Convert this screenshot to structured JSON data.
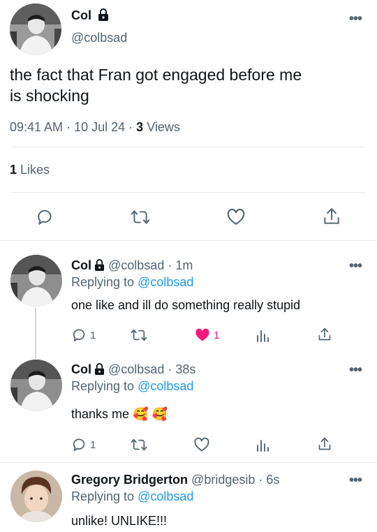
{
  "main_tweet": {
    "author_name": "Col",
    "author_handle": "@colbsad",
    "text_line1": "the fact that Fran got engaged before me",
    "text_line2": "is shocking",
    "time": "09:41 AM",
    "date": "10 Jul 24",
    "views_count": "3",
    "views_label": "Views",
    "likes_count": "1",
    "likes_label": "Likes"
  },
  "replies": [
    {
      "author_name": "Col",
      "author_handle": "@colbsad",
      "age": "· 1m",
      "replying_prefix": "Replying to",
      "replying_to": "@colbsad",
      "text": "one like and ill do something really stupid",
      "reply_count": "1",
      "retweet_count": "",
      "like_count": "1",
      "liked": true
    },
    {
      "author_name": "Col",
      "author_handle": "@colbsad",
      "age": "· 38s",
      "replying_prefix": "Replying to",
      "replying_to": "@colbsad",
      "text": "thanks me 🥰 🥰",
      "reply_count": "1",
      "retweet_count": "",
      "like_count": "",
      "liked": false
    },
    {
      "author_name": "Gregory Bridgerton",
      "author_handle": "@bridgesib",
      "age": "· 6s",
      "replying_prefix": "Replying to",
      "replying_to": "@colbsad",
      "text": "unlike! UNLIKE!!!"
    }
  ],
  "colors": {
    "link": "#1d9bf0",
    "muted": "#536471",
    "like": "#f91880"
  }
}
